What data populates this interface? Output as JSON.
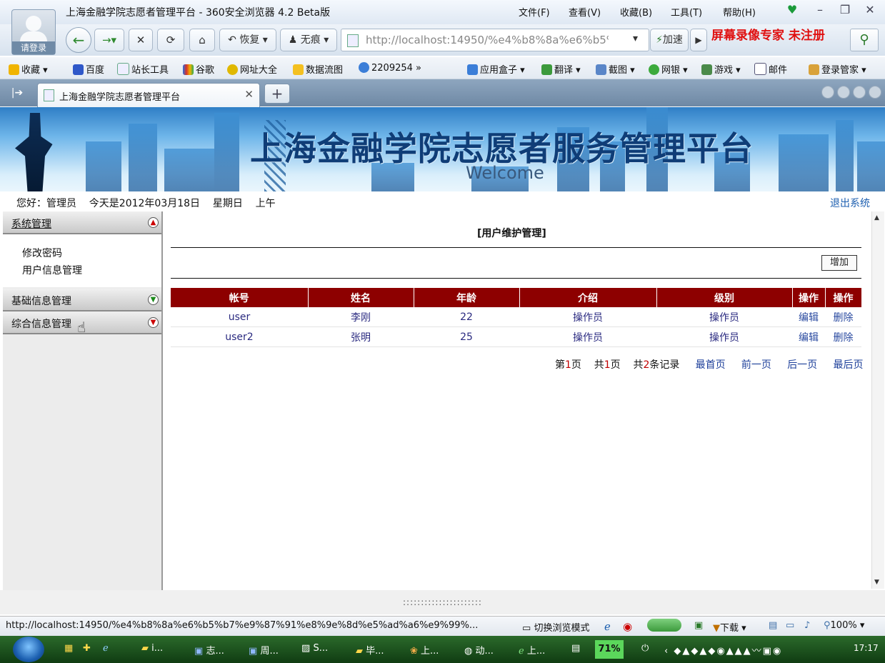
{
  "browser": {
    "window_title": "上海金融学院志愿者管理平台 - 360安全浏览器 4.2 Beta版",
    "avatar_label": "请登录",
    "menu": [
      "文件(F)",
      "查看(V)",
      "收藏(B)",
      "工具(T)",
      "帮助(H)"
    ],
    "nav": {
      "restore": "恢复",
      "private": "无痕",
      "speed": "加速"
    },
    "url": "http://localhost:14950/%e4%b8%8a%e6%b5%",
    "watermark": "屏幕录像专家 未注册",
    "favorites_left": [
      "收藏",
      "百度",
      "站长工具",
      "谷歌",
      "网址大全",
      "数据流图",
      "2209254"
    ],
    "favorites_right": [
      "应用盒子",
      "翻译",
      "截图",
      "网银",
      "游戏",
      "邮件",
      "登录管家"
    ],
    "tab_title": "上海金融学院志愿者管理平台"
  },
  "banner": {
    "title": "上海金融学院志愿者服务管理平台",
    "welcome": "Welcome"
  },
  "infobar": {
    "greeting": "您好：管理员    今天是2012年03月18日    星期日    上午",
    "logout": "退出系统"
  },
  "sidebar": {
    "sections": [
      {
        "label": "系统管理",
        "items": [
          "修改密码",
          "用户信息管理"
        ]
      },
      {
        "label": "基础信息管理"
      },
      {
        "label": "综合信息管理"
      }
    ]
  },
  "main": {
    "title": "[用户维护管理]",
    "add_button": "增加",
    "columns": [
      "帐号",
      "姓名",
      "年龄",
      "介绍",
      "级别",
      "操作",
      "操作"
    ],
    "rows": [
      [
        "user",
        "李刚",
        "22",
        "操作员",
        "操作员",
        "编辑",
        "删除"
      ],
      [
        "user2",
        "张明",
        "25",
        "操作员",
        "操作员",
        "编辑",
        "删除"
      ]
    ],
    "pager": {
      "page_prefix": "第",
      "page": "1",
      "page_suffix": "页",
      "total_prefix": "共",
      "total_pages": "1",
      "total_suffix": "页",
      "records_prefix": "共",
      "records": "2",
      "records_suffix": "条记录",
      "first": "最首页",
      "prev": "前一页",
      "next": "后一页",
      "last": "最后页"
    }
  },
  "statusbar": {
    "url": "http://localhost:14950/%e4%b8%8a%e6%b5%b7%e9%87%91%e8%9e%8d%e5%ad%a6%e9%99%...",
    "mode": "切换浏览模式",
    "download": "下载",
    "zoom": "100%"
  },
  "taskbar": {
    "items": [
      "i...",
      "志...",
      "周...",
      "S...",
      "毕...",
      "上...",
      "动...",
      "上..."
    ],
    "battery": "71%",
    "clock": "17:17"
  }
}
